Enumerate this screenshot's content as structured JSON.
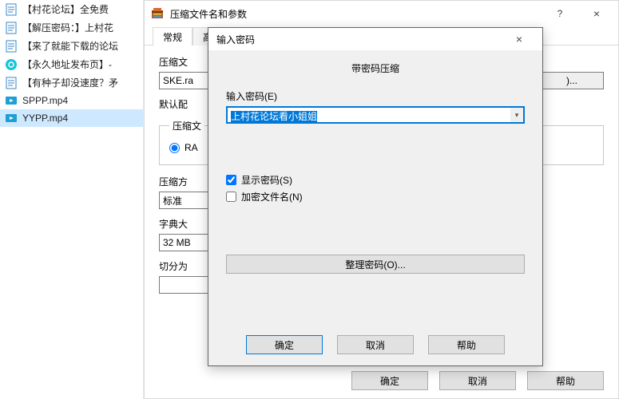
{
  "files": [
    {
      "label": "【村花论坛】全免费",
      "icon": "text"
    },
    {
      "label": "【解压密码：】上村花",
      "icon": "text"
    },
    {
      "label": "【来了就能下载的论坛",
      "icon": "text"
    },
    {
      "label": "【永久地址发布页】-",
      "icon": "link"
    },
    {
      "label": "【有种子却没速度？矛",
      "icon": "text"
    },
    {
      "label": "SPPP.mp4",
      "icon": "video"
    },
    {
      "label": "YYPP.mp4",
      "icon": "video"
    }
  ],
  "selected_index": 6,
  "main": {
    "title": "压缩文件名和参数",
    "help_glyph": "?",
    "close_glyph": "×",
    "tabs": [
      "常规",
      "高"
    ],
    "archive_label": "压缩文",
    "archive_value": "SKE.ra",
    "browse_btn_partial": ")...",
    "profile_label": "默认配",
    "format_legend": "压缩文",
    "format_rar": "RA",
    "method_label": "压缩方",
    "method_value": "标准",
    "dict_label": "字典大",
    "dict_value": "32 MB",
    "split_label": "切分为",
    "split_value": "",
    "ok": "确定",
    "cancel": "取消",
    "help": "帮助"
  },
  "pwd": {
    "title": "输入密码",
    "heading": "带密码压缩",
    "enter_label": "输入密码(E)",
    "value": "上村花论坛看小姐姐",
    "show_pwd": "显示密码(S)",
    "encrypt_names": "加密文件名(N)",
    "show_checked": true,
    "encrypt_checked": false,
    "organize": "整理密码(O)...",
    "ok": "确定",
    "cancel": "取消",
    "help": "帮助"
  }
}
